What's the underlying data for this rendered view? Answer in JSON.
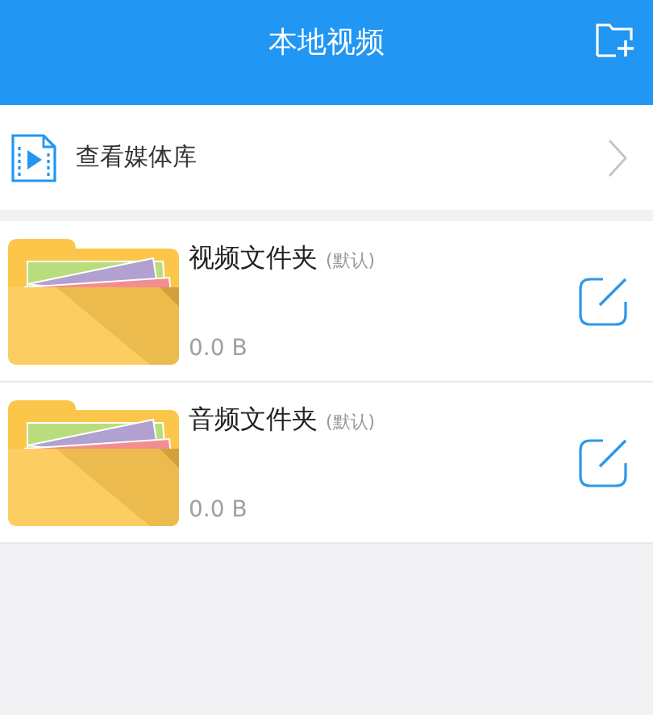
{
  "header": {
    "title": "本地视频"
  },
  "media_library": {
    "label": "查看媒体库"
  },
  "folders": [
    {
      "name": "视频文件夹",
      "tag": "(默认)",
      "size": "0.0 B"
    },
    {
      "name": "音频文件夹",
      "tag": "(默认)",
      "size": "0.0 B"
    }
  ]
}
